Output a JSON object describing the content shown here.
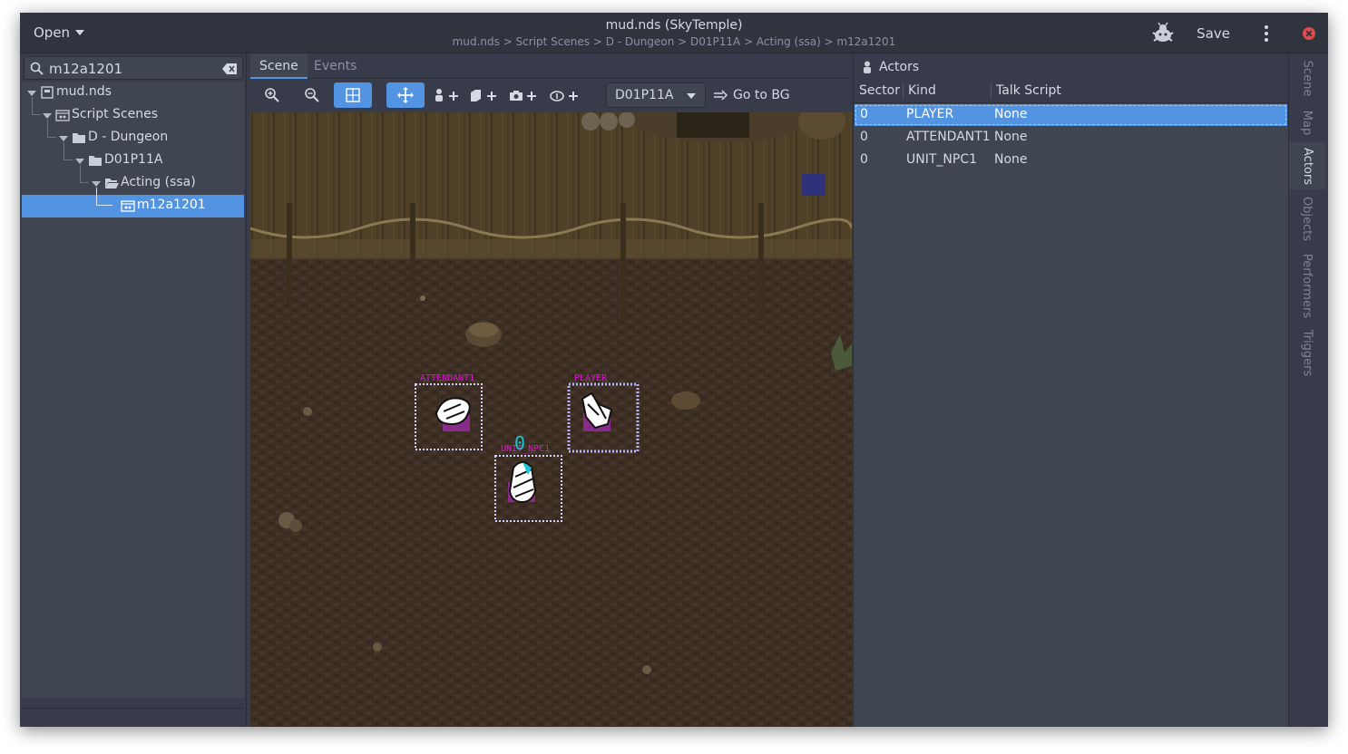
{
  "header": {
    "open_label": "Open",
    "title": "mud.nds (SkyTemple)",
    "subtitle": "mud.nds > Script Scenes > D - Dungeon > D01P11A > Acting (ssa) > m12a1201",
    "save_label": "Save"
  },
  "sidebar": {
    "search_value": "m12a1201",
    "tree": [
      {
        "label": "mud.nds",
        "icon": "rom-icon"
      },
      {
        "label": "Script Scenes",
        "icon": "scene-icon"
      },
      {
        "label": "D - Dungeon",
        "icon": "folder-icon"
      },
      {
        "label": "D01P11A",
        "icon": "folder-icon"
      },
      {
        "label": "Acting (ssa)",
        "icon": "folder-open-icon"
      },
      {
        "label": "m12a1201",
        "icon": "scene-icon"
      }
    ]
  },
  "center": {
    "tabs": [
      "Scene",
      "Events"
    ],
    "map_select": "D01P11A",
    "goto_bg_label": "Go to BG",
    "actor_labels": {
      "attendant": "ATTENDANT1",
      "player": "PLAYER",
      "unit_npc": "UNIT_NPC1",
      "sector_marker": "0"
    }
  },
  "actors_panel": {
    "title": "Actors",
    "columns": [
      "Sector",
      "Kind",
      "Talk Script"
    ],
    "rows": [
      {
        "sector": "0",
        "kind": "PLAYER",
        "talk_script": "None"
      },
      {
        "sector": "0",
        "kind": "ATTENDANT1",
        "talk_script": "None"
      },
      {
        "sector": "0",
        "kind": "UNIT_NPC1",
        "talk_script": "None"
      }
    ]
  },
  "side_tabs": [
    "Scene",
    "Map",
    "Actors",
    "Objects",
    "Performers",
    "Triggers"
  ],
  "colors": {
    "accent": "#5294e2",
    "actor_label": "#e011d8",
    "sector_marker": "#12c8d8"
  }
}
